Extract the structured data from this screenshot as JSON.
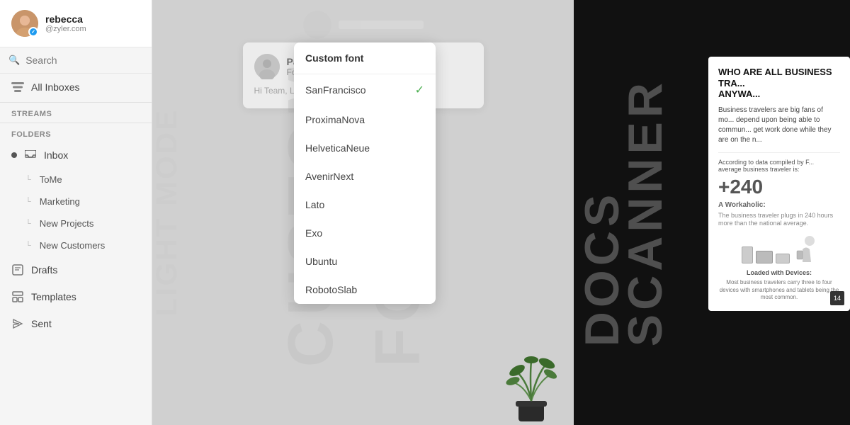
{
  "profile": {
    "name": "rebecca",
    "handle": "@zyler.com"
  },
  "search": {
    "placeholder": "Search"
  },
  "nav": {
    "all_inboxes": "All Inboxes",
    "streams_label": "STREAMS",
    "folders_label": "FOLDERS",
    "inbox": "Inbox",
    "sub_items": [
      {
        "label": "ToMe"
      },
      {
        "label": "Marketing"
      },
      {
        "label": "New Projects"
      },
      {
        "label": "New Customers"
      }
    ],
    "drafts": "Drafts",
    "templates": "Templates",
    "sent": "Sent"
  },
  "email": {
    "sender_name": "Paula M",
    "subject": "Font change",
    "preview": "Hi Team, Let's u... mobile app. Reg..."
  },
  "font_dropdown": {
    "header": "Custom font",
    "fonts": [
      {
        "name": "SanFrancisco",
        "selected": true
      },
      {
        "name": "ProximaNova",
        "selected": false
      },
      {
        "name": "HelveticaNeue",
        "selected": false
      },
      {
        "name": "AvenirNext",
        "selected": false
      },
      {
        "name": "Lato",
        "selected": false
      },
      {
        "name": "Exo",
        "selected": false
      },
      {
        "name": "Ubuntu",
        "selected": false
      },
      {
        "name": "RobotoSlab",
        "selected": false
      }
    ]
  },
  "watermark": {
    "line1": "CUSTOM",
    "line2": "FONTS"
  },
  "lightmode": {
    "text": "LIGHT MODE"
  },
  "right_panel": {
    "docs": "DOCS",
    "scanner": "SCANNER"
  },
  "article": {
    "title": "WHO ARE ALL BUSINESS TRA... ANYWA...",
    "body": "Business travelers are big fans of mo... depend upon being able to commun... get work done while they are on the n...",
    "stat": "+240",
    "stat_label": "A Workaholic:",
    "stat_desc": "The business traveler plugs in 240 hours more than the national average.",
    "loaded_title": "Loaded with Devices:",
    "loaded_desc": "Most business travelers carry three to four devices with smartphones and tablets being the most common.",
    "page_num": "14"
  }
}
